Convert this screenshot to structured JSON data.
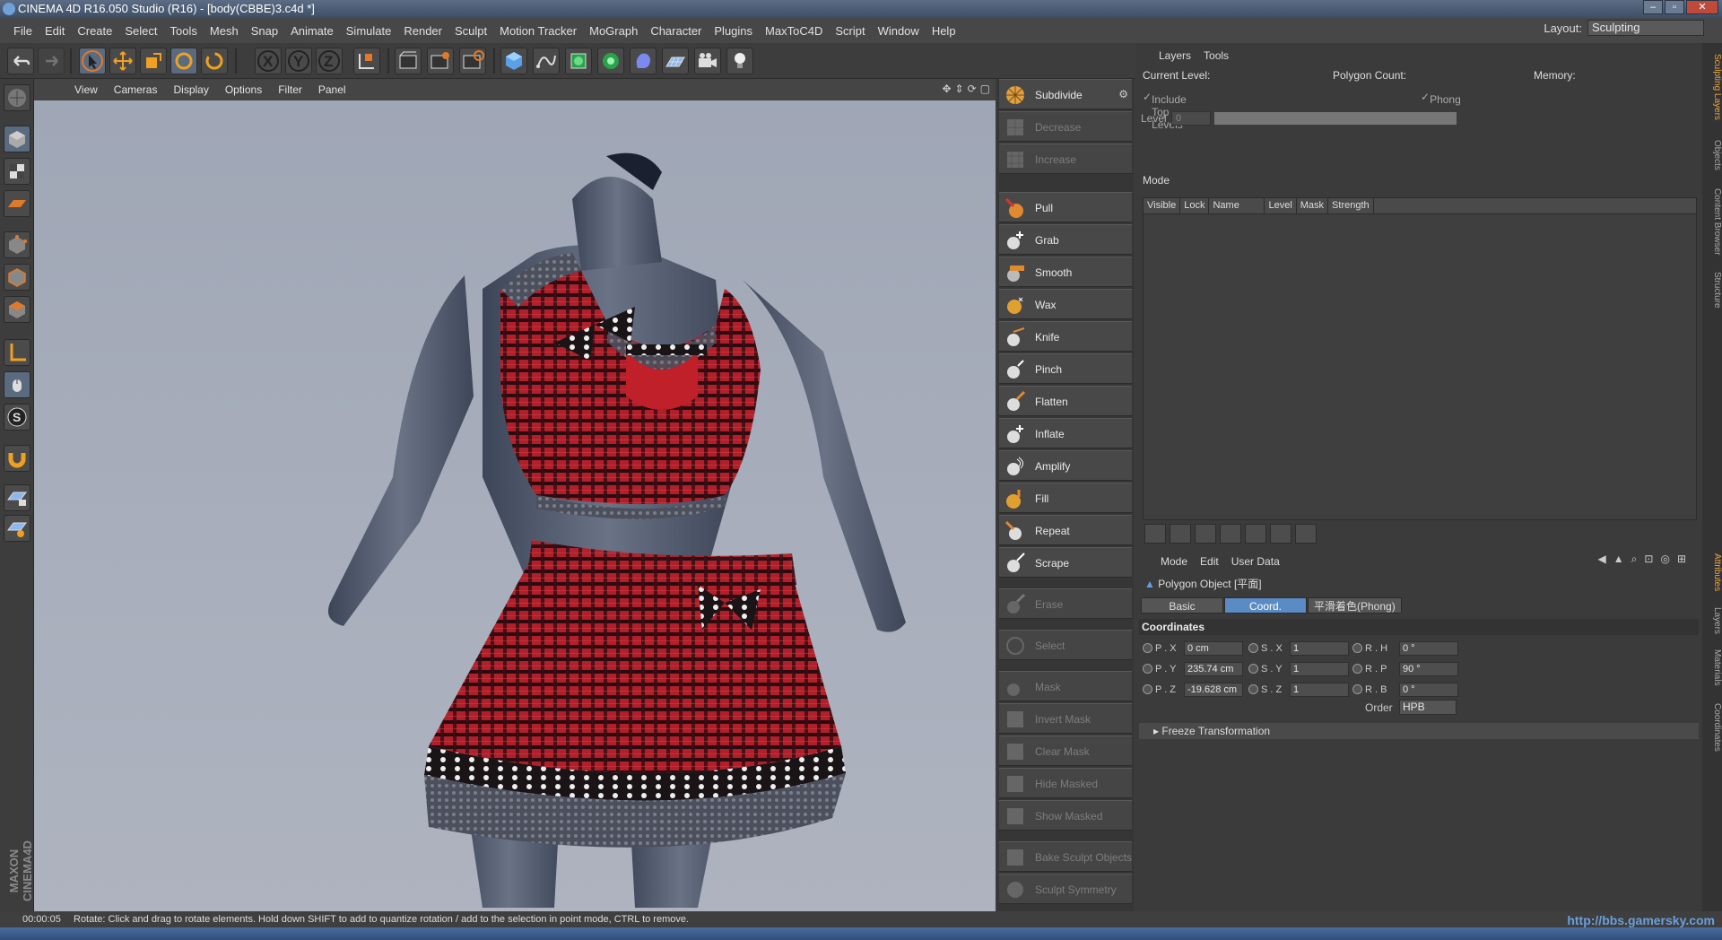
{
  "window": {
    "title": "CINEMA 4D R16.050 Studio (R16) - [body(CBBE)3.c4d *]"
  },
  "menu": [
    "File",
    "Edit",
    "Create",
    "Select",
    "Tools",
    "Mesh",
    "Snap",
    "Animate",
    "Simulate",
    "Render",
    "Sculpt",
    "Motion Tracker",
    "MoGraph",
    "Character",
    "Plugins",
    "MaxToC4D",
    "Script",
    "Window",
    "Help"
  ],
  "layout": {
    "label": "Layout:",
    "value": "Sculpting"
  },
  "viewport_menu": [
    "View",
    "Cameras",
    "Display",
    "Options",
    "Filter",
    "Panel"
  ],
  "sculpt_tools": {
    "subdivide": "Subdivide",
    "decrease": "Decrease",
    "increase": "Increase",
    "brushes": [
      "Pull",
      "Grab",
      "Smooth",
      "Wax",
      "Knife",
      "Pinch",
      "Flatten",
      "Inflate",
      "Amplify",
      "Fill",
      "Repeat",
      "Scrape"
    ],
    "erase": "Erase",
    "select": "Select",
    "mask_tools": [
      "Mask",
      "Invert Mask",
      "Clear Mask",
      "Hide Masked",
      "Show Masked"
    ],
    "bake": "Bake Sculpt Objects",
    "symmetry": "Sculpt Symmetry"
  },
  "layers_panel": {
    "tabs": [
      "Layers",
      "Tools"
    ],
    "current_level": "Current Level:",
    "polygon_count": "Polygon Count:",
    "memory": "Memory:",
    "include_top_levels": "Include Top Levels",
    "phong": "Phong",
    "level_label": "Level",
    "level_value": "0",
    "mode": "Mode",
    "columns": [
      "Visible",
      "Lock",
      "Name",
      "Level",
      "Mask",
      "Strength"
    ]
  },
  "attributes_panel": {
    "menu": [
      "Mode",
      "Edit",
      "User Data"
    ],
    "object_label": "Polygon Object [平面]",
    "tabs": [
      "Basic",
      "Coord.",
      "平滑着色(Phong)"
    ],
    "active_tab": "Coord.",
    "section": "Coordinates",
    "rows": [
      {
        "p_name": "P . X",
        "p_val": "0 cm",
        "s_name": "S . X",
        "s_val": "1",
        "r_name": "R . H",
        "r_val": "0 °"
      },
      {
        "p_name": "P . Y",
        "p_val": "235.74 cm",
        "s_name": "S . Y",
        "s_val": "1",
        "r_name": "R . P",
        "r_val": "90 °"
      },
      {
        "p_name": "P . Z",
        "p_val": "-19.628 cm",
        "s_name": "S . Z",
        "s_val": "1",
        "r_name": "R . B",
        "r_val": "0 °"
      }
    ],
    "order_label": "Order",
    "order_value": "HPB",
    "freeze": "Freeze Transformation"
  },
  "side_tabs_top": [
    "Sculpting Layers",
    "Objects",
    "Content Browser",
    "Structure"
  ],
  "side_tabs_bottom": [
    "Attributes",
    "Layers",
    "Materials",
    "Coordinates"
  ],
  "status": {
    "time": "00:00:05",
    "message": "Rotate: Click and drag to rotate elements. Hold down SHIFT to add to quantize rotation / add to the selection in point mode, CTRL to remove."
  },
  "brand": "MAXON CINEMA4D",
  "watermark": "http://bbs.gamersky.com",
  "colors": {
    "accent": "#5b8bc4",
    "plaid": "#b0202a",
    "skin": "#5d6677",
    "viewport_bg": "#a7adba"
  }
}
